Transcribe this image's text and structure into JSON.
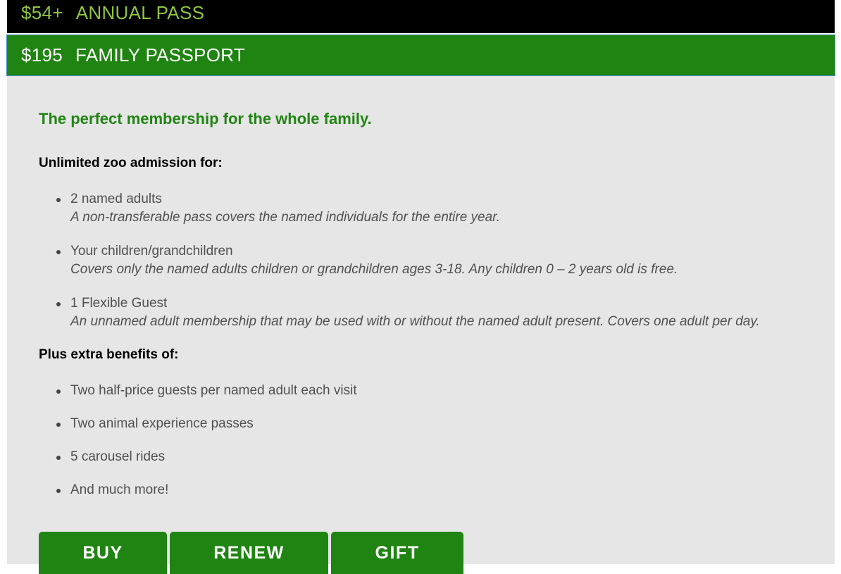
{
  "header": {
    "accent_colors": [
      "#c8d62b",
      "#61c5c0",
      "#fec20f"
    ]
  },
  "annual_pass": {
    "price": "$54+",
    "title": "ANNUAL PASS",
    "color": "#8fc63f"
  },
  "family_passport": {
    "price": "$195",
    "title": "FAMILY PASSPORT",
    "color": "#208412"
  },
  "content": {
    "tagline": "The perfect membership for the whole family.",
    "admission_heading": "Unlimited zoo admission for:",
    "admission_items": [
      {
        "label": "2 named adults",
        "detail": "A non-transferable pass covers the named individuals for the entire year."
      },
      {
        "label": "Your children/grandchildren",
        "detail": "Covers only the named adults children or grandchildren ages 3-18. Any children 0 – 2 years old is free."
      },
      {
        "label": "1 Flexible Guest",
        "detail": "An unnamed adult membership that may be used with or without the named adult present. Covers one adult per day."
      }
    ],
    "benefits_heading": "Plus extra benefits of:",
    "benefit_items": [
      "Two half-price guests per named adult each visit",
      "Two animal experience passes",
      "5 carousel rides",
      "And much more!"
    ]
  },
  "actions": {
    "buy_label": "BUY",
    "renew_label": "RENEW",
    "gift_label": "GIFT"
  }
}
